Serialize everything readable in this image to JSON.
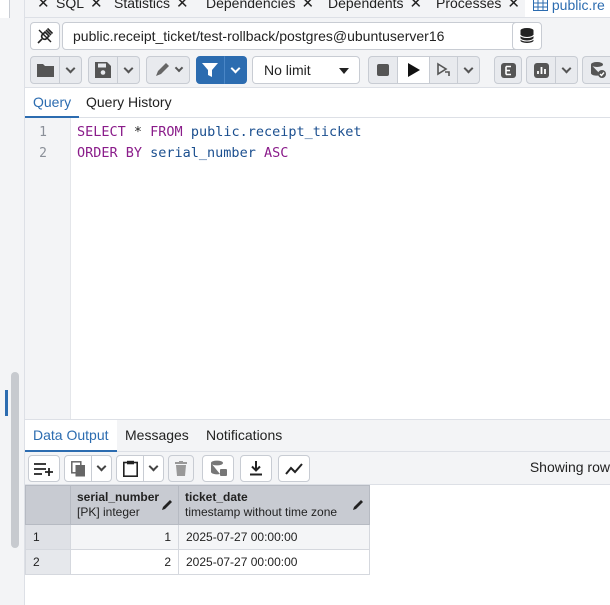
{
  "tabs": [
    {
      "label": "",
      "closable": true
    },
    {
      "label": "SQL",
      "closable": true
    },
    {
      "label": "Statistics",
      "closable": true
    },
    {
      "label": "Dependencies",
      "closable": true
    },
    {
      "label": "Dependents",
      "closable": true
    },
    {
      "label": "Processes",
      "closable": false
    },
    {
      "label": "public.re",
      "active": true
    }
  ],
  "connection": {
    "label": "public.receipt_ticket/test-rollback/postgres@ubuntuserver16"
  },
  "toolbar": {
    "limit_value": "No limit"
  },
  "query_tabs": [
    "Query",
    "Query History"
  ],
  "editor": {
    "line_numbers": [
      "1",
      "2"
    ],
    "line1": {
      "kw1": "SELECT",
      "star": " * ",
      "kw2": "FROM",
      "ident": " public.receipt_ticket"
    },
    "line2": {
      "kw1": "ORDER BY",
      "ident": " serial_number ",
      "kw2": "ASC"
    }
  },
  "output_tabs": [
    "Data Output",
    "Messages",
    "Notifications"
  ],
  "output": {
    "showing_text": "Showing row"
  },
  "grid": {
    "columns": [
      {
        "name": "serial_number",
        "type": "[PK] integer"
      },
      {
        "name": "ticket_date",
        "type": "timestamp without time zone"
      }
    ],
    "rows": [
      {
        "num": "1",
        "serial_number": "1",
        "ticket_date": "2025-07-27 00:00:00"
      },
      {
        "num": "2",
        "serial_number": "2",
        "ticket_date": "2025-07-27 00:00:00"
      }
    ]
  },
  "colors": {
    "accent": "#2c6cb0",
    "keyword": "#8a1c8a",
    "identifier": "#1b4f8f"
  }
}
